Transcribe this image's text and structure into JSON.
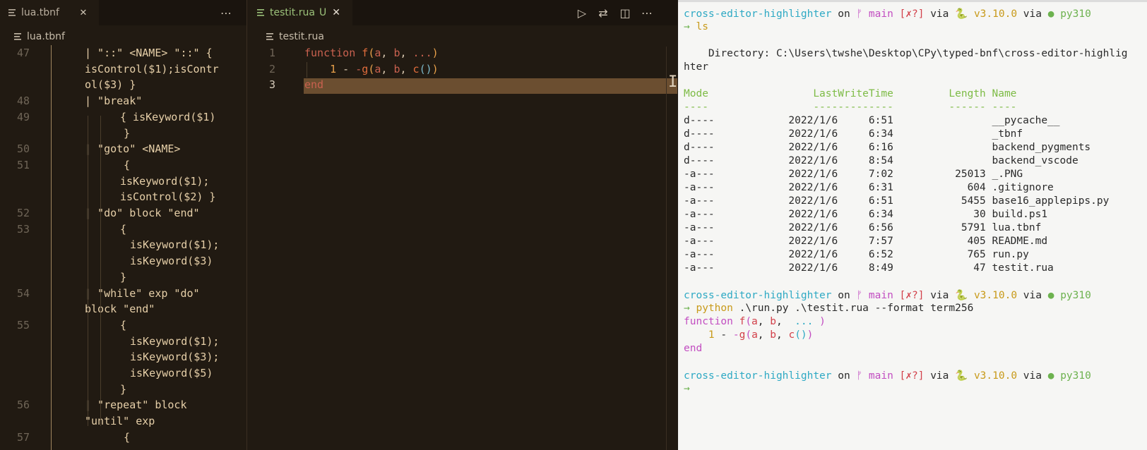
{
  "left_editor": {
    "tab": {
      "label": "lua.tbnf",
      "close": "✕",
      "more": "⋯"
    },
    "breadcrumb": "lua.tbnf",
    "lines": [
      {
        "num": "47",
        "text": "| \"::\" <NAME> \"::\" {",
        "indent": 0
      },
      {
        "num": "",
        "text": "isControl($1);isContr",
        "indent": 1
      },
      {
        "num": "",
        "text": "ol($3) }",
        "indent": 1
      },
      {
        "num": "48",
        "text": "| \"break\"",
        "indent": 0
      },
      {
        "num": "49",
        "text": "{ isKeyword($1)",
        "indent": 2
      },
      {
        "num": "",
        "text": "}",
        "indent": 3
      },
      {
        "num": "50",
        "text": "| \"goto\" <NAME>",
        "indent": 0
      },
      {
        "num": "51",
        "text": "{",
        "indent": 3
      },
      {
        "num": "",
        "text": "isKeyword($1);",
        "indent": 2
      },
      {
        "num": "",
        "text": "isControl($2) }",
        "indent": 2
      },
      {
        "num": "52",
        "text": "| \"do\" block \"end\"",
        "indent": 0
      },
      {
        "num": "53",
        "text": "{",
        "indent": 4
      },
      {
        "num": "",
        "text": "isKeyword($1);",
        "indent": 5
      },
      {
        "num": "",
        "text": "isKeyword($3)",
        "indent": 5
      },
      {
        "num": "",
        "text": "}",
        "indent": 4
      },
      {
        "num": "54",
        "text": "| \"while\" exp \"do\"",
        "indent": 0
      },
      {
        "num": "",
        "text": "block \"end\"",
        "indent": 1
      },
      {
        "num": "55",
        "text": "{",
        "indent": 4
      },
      {
        "num": "",
        "text": "isKeyword($1);",
        "indent": 5
      },
      {
        "num": "",
        "text": "isKeyword($3);",
        "indent": 5
      },
      {
        "num": "",
        "text": "isKeyword($5)",
        "indent": 5
      },
      {
        "num": "",
        "text": "}",
        "indent": 4
      },
      {
        "num": "56",
        "text": "| \"repeat\" block",
        "indent": 0
      },
      {
        "num": "",
        "text": "\"until\" exp",
        "indent": 1
      },
      {
        "num": "57",
        "text": "{",
        "indent": 3
      }
    ]
  },
  "mid_editor": {
    "tab": {
      "label": "testit.rua",
      "status": "U",
      "close": "✕"
    },
    "actions": {
      "run": "▷",
      "compare": "⇄",
      "split": "◫",
      "more": "⋯"
    },
    "breadcrumb": "testit.rua",
    "lines": [
      {
        "num": "1",
        "parts": [
          [
            "function ",
            "#c9614f"
          ],
          [
            "f",
            "#e06c3c"
          ],
          [
            "(",
            "#e8a04a"
          ],
          [
            "a",
            "#c9614f"
          ],
          [
            ", ",
            "#d8c8b0"
          ],
          [
            "b",
            "#c9614f"
          ],
          [
            ", ",
            "#d8c8b0"
          ],
          [
            "...",
            "#c9614f"
          ],
          [
            ")",
            "#e8a04a"
          ]
        ]
      },
      {
        "num": "2",
        "parts": [
          [
            "    ",
            "#d8c8b0"
          ],
          [
            "1",
            "#e8a04a"
          ],
          [
            " - ",
            "#d8c8b0"
          ],
          [
            "-",
            "#c9614f"
          ],
          [
            "g",
            "#e06c3c"
          ],
          [
            "(",
            "#e8a04a"
          ],
          [
            "a",
            "#c9614f"
          ],
          [
            ", ",
            "#d8c8b0"
          ],
          [
            "b",
            "#c9614f"
          ],
          [
            ", ",
            "#d8c8b0"
          ],
          [
            "c",
            "#e06c3c"
          ],
          [
            "()",
            "#7cb8c9"
          ],
          [
            ")",
            "#e8a04a"
          ]
        ]
      },
      {
        "num": "3",
        "parts": [
          [
            "end",
            "#c9614f"
          ]
        ]
      }
    ]
  },
  "terminal": {
    "prompt": {
      "dir": "cross-editor-highlighter",
      "on": "on",
      "branch_icon": "ᚠ",
      "branch": "main",
      "status": "[✗?]",
      "via": "via",
      "py_icon": "🐍",
      "version": "v3.10.0",
      "env_icon": "●",
      "env": "py310",
      "arrow": "→"
    },
    "cmd1": "ls",
    "directory_line1": "    Directory: C:\\Users\\twshe\\Desktop\\CPy\\typed-bnf\\cross-editor-highlig",
    "directory_line2": "hter",
    "headers": "Mode                 LastWriteTime         Length Name",
    "underline": "----                 -------------         ------ ----",
    "rows": [
      "d----            2022/1/6     6:51                __pycache__",
      "d----            2022/1/6     6:34                _tbnf",
      "d----            2022/1/6     6:16                backend_pygments",
      "d----            2022/1/6     8:54                backend_vscode",
      "-a---            2022/1/6     7:02          25013 _.PNG",
      "-a---            2022/1/6     6:31            604 .gitignore",
      "-a---            2022/1/6     6:51           5455 base16_applepips.py",
      "-a---            2022/1/6     6:34             30 build.ps1",
      "-a---            2022/1/6     6:56           5791 lua.tbnf",
      "-a---            2022/1/6     7:57            405 README.md",
      "-a---            2022/1/6     6:52            765 run.py",
      "-a---            2022/1/6     8:49             47 testit.rua"
    ],
    "cmd2_word": "python",
    "cmd2_args": " .\\run.py .\\testit.rua --format term256",
    "out": {
      "l1_kw": "function ",
      "l1_fn": "f",
      "l1_p": "(",
      "l1_a": "a",
      "l1_c1": ", ",
      "l1_b": "b",
      "l1_c2": ", ",
      "l1_dots": " ... ",
      "l1_pc": ")",
      "l2_num": "    1",
      "l2_minus": " - ",
      "l2_neg": "-",
      "l2_g": "g",
      "l2_p": "(",
      "l2_a": "a",
      "l2_c1": ", ",
      "l2_b": "b",
      "l2_c2": ", ",
      "l2_c": "c",
      "l2_call": "()",
      "l2_pc": ")",
      "l3": "end"
    }
  }
}
